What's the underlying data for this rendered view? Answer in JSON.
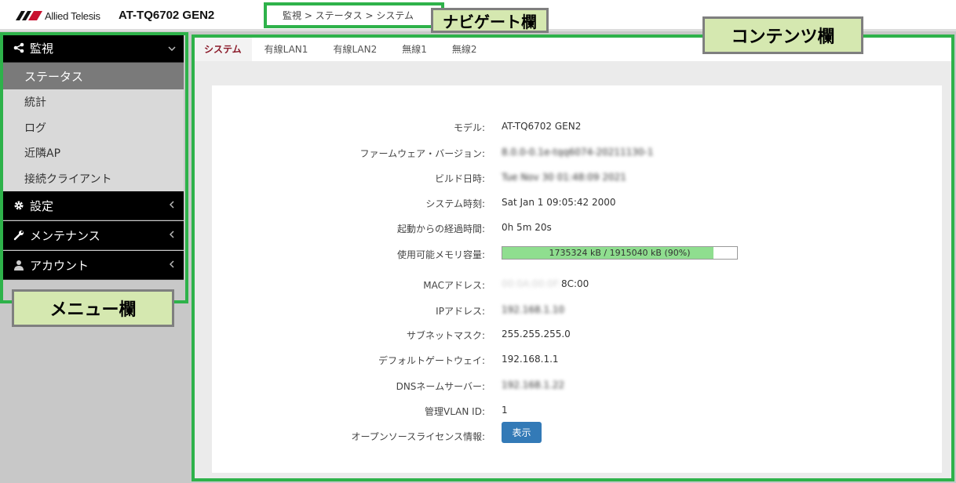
{
  "header": {
    "logo_text": "Allied Telesis",
    "model": "AT-TQ6702 GEN2",
    "breadcrumb": "監視 > ステータス > システム"
  },
  "sidebar": {
    "groups": [
      {
        "label": "監視",
        "icon": "share-icon",
        "caret": "chevron-down-icon",
        "expanded": true
      },
      {
        "label": "設定",
        "icon": "gear-icon",
        "caret": "chevron-left-icon"
      },
      {
        "label": "メンテナンス",
        "icon": "wrench-icon",
        "caret": "chevron-left-icon"
      },
      {
        "label": "アカウント",
        "icon": "user-icon",
        "caret": "chevron-left-icon"
      }
    ],
    "monitor_items": [
      {
        "label": "ステータス",
        "active": true
      },
      {
        "label": "統計"
      },
      {
        "label": "ログ"
      },
      {
        "label": "近隣AP"
      },
      {
        "label": "接続クライアント"
      }
    ]
  },
  "tabs": [
    {
      "label": "システム",
      "active": true
    },
    {
      "label": "有線LAN1"
    },
    {
      "label": "有線LAN2"
    },
    {
      "label": "無線1"
    },
    {
      "label": "無線2"
    }
  ],
  "system_info": {
    "model_label": "モデル:",
    "model_value": "AT-TQ6702 GEN2",
    "firmware_label": "ファームウェア・バージョン:",
    "firmware_value": "8.0.0-0.1e-tqq6074-20211130-1",
    "build_label": "ビルド日時:",
    "build_value": "Tue Nov 30 01:48:09 2021",
    "system_time_label": "システム時刻:",
    "system_time_value": "Sat Jan 1 09:05:42 2000",
    "uptime_label": "起動からの経過時間:",
    "uptime_value": "0h 5m 20s",
    "memory_label": "使用可能メモリ容量:",
    "memory_text": "1735324 kB / 1915040 kB (90%)",
    "memory_fraction": 0.9,
    "mac_label": "MACアドレス:",
    "mac_blurred_part": "00:0A:00:0F:",
    "mac_visible_part": "8C:00",
    "ip_label": "IPアドレス:",
    "ip_value": "192.168.1.10",
    "subnet_label": "サブネットマスク:",
    "subnet_value": "255.255.255.0",
    "gateway_label": "デフォルトゲートウェイ:",
    "gateway_value": "192.168.1.1",
    "dns_label": "DNSネームサーバー:",
    "dns_value": "192.168.1.22",
    "vlan_label": "管理VLAN ID:",
    "vlan_value": "1",
    "oss_label": "オープンソースライセンス情報:",
    "oss_button": "表示"
  },
  "annotations": {
    "nav_label": "ナビゲート欄",
    "content_label": "コンテンツ欄",
    "menu_label": "メニュー欄",
    "color": "#2eb24a"
  }
}
